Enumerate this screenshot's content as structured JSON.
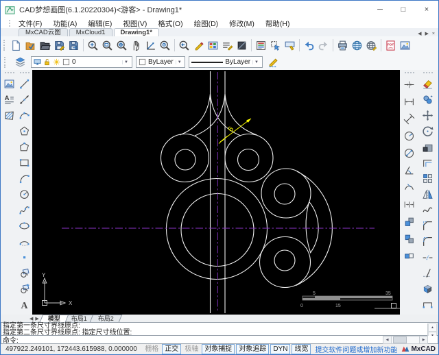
{
  "window": {
    "title": "CAD梦想画图(6.1.20220304)<游客> - Drawing1*",
    "controls": {
      "minimize": "─",
      "maximize": "□",
      "close": "×"
    }
  },
  "menu": {
    "items": [
      "文件(F)",
      "功能(A)",
      "编辑(E)",
      "视图(V)",
      "格式(O)",
      "绘图(D)",
      "修改(M)",
      "帮助(H)"
    ]
  },
  "doc_tabs": {
    "items": [
      {
        "label": "MxCAD云图",
        "active": false
      },
      {
        "label": "MxCloud1",
        "active": false
      },
      {
        "label": "Drawing1*",
        "active": true
      }
    ],
    "nav": [
      "◀",
      "▶",
      "×"
    ]
  },
  "toolbar_top": {
    "icons": [
      "new-file",
      "open-cloud-folder",
      "open-file",
      "save",
      "save-as",
      "|",
      "zoom-dynamic",
      "zoom-window",
      "zoom-extents",
      "pan",
      "zoom-axis",
      "zoom-center",
      "|",
      "zoom-previous",
      "edit-pencil",
      "color-palette",
      "linetype-manager",
      "layer-box",
      "|",
      "properties-window",
      "selection-style",
      "format-brush",
      "|",
      "undo",
      "redo",
      "|",
      "print",
      "web-publish",
      "web-upload",
      "|",
      "export-pdf",
      "insert-image"
    ]
  },
  "layer_bar": {
    "layer_value": "0",
    "color_value": "ByLayer",
    "linetype_value": "ByLayer"
  },
  "left_toolbar_a": {
    "icons": [
      "raster-image",
      "text-content",
      "hatch"
    ]
  },
  "left_toolbar_b": {
    "icons": [
      "line",
      "construction-line",
      "arc-3point",
      "polygon",
      "polyline",
      "rectangle",
      "arc",
      "circle",
      "spline",
      "ellipse",
      "ellipse-arc",
      "point",
      "block-copy",
      "insert-block",
      "single-text"
    ]
  },
  "right_toolbar_dim": {
    "icons": [
      "dim-align",
      "dim-linear",
      "dim-aligned",
      "dim-radius",
      "dim-diameter",
      "dim-angular",
      "dim-arc-length",
      "dim-continue",
      "dim-quick",
      "dim-baseline",
      "dim-edit"
    ]
  },
  "right_toolbar_modify": {
    "icons": [
      "erase",
      "copy",
      "move",
      "rotate",
      "scale",
      "offset",
      "array",
      "mirror",
      "stretch-curve",
      "chamfer",
      "fillet",
      "break",
      "trim",
      "explode",
      "join"
    ]
  },
  "canvas": {
    "dim_text": "6",
    "scale_labels": {
      "v5": "5",
      "v35": "35",
      "v0": "0",
      "v15": "15"
    },
    "ucs": {
      "x_label": "X",
      "y_label": "Y"
    },
    "colors": {
      "background": "#000000",
      "geometry": "#efefef",
      "centerline": "#8b34c9",
      "dimension": "#ffff00",
      "scale_bar": "#8f8f8f"
    }
  },
  "layout_tabs": {
    "nav": [
      "◀",
      "▶"
    ],
    "items": [
      {
        "label": "模型",
        "active": true
      },
      {
        "label": "布局1",
        "active": false
      },
      {
        "label": "布局2",
        "active": false
      }
    ]
  },
  "command": {
    "history": [
      "指定第一条尺寸界线原点:",
      "指定第二条尺寸界线原点:  指定尺寸线位置:"
    ],
    "prompt": "命令:"
  },
  "status_bar": {
    "coordinates": "497922.249101, 172443.615988, 0.000000",
    "toggles": [
      {
        "label": "栅格",
        "on": false
      },
      {
        "label": "正交",
        "on": true
      },
      {
        "label": "极轴",
        "on": false
      },
      {
        "label": "对象捕捉",
        "on": true
      },
      {
        "label": "对象追踪",
        "on": true
      },
      {
        "label": "DYN",
        "on": true
      },
      {
        "label": "线宽",
        "on": true
      }
    ],
    "link": "提交软件问题或增加新功能",
    "brand": "MxCAD"
  }
}
